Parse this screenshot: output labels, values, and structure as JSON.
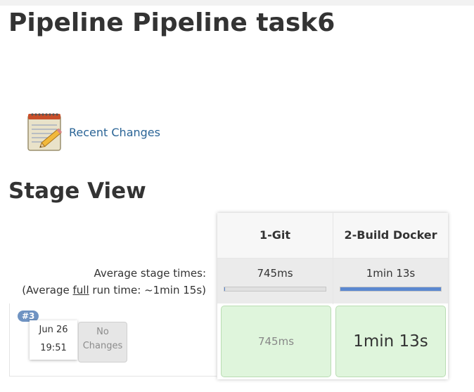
{
  "page": {
    "title": "Pipeline Pipeline task6",
    "recent_changes_label": "Recent Changes",
    "section_title": "Stage View"
  },
  "stage_view": {
    "average_label": "Average stage times:",
    "avg_full_prefix": "(Average ",
    "avg_full_word": "full",
    "avg_full_suffix": " run time: ~1min 15s)",
    "stages": [
      {
        "name": "1-Git",
        "avg_time": "745ms",
        "avg_progress": 0.01
      },
      {
        "name": "2-Build Docker",
        "avg_time": "1min 13s",
        "avg_progress": 1.0
      }
    ],
    "runs": [
      {
        "build": "#3",
        "date": "Jun 26",
        "time": "19:51",
        "changes": [
          "No",
          "Changes"
        ],
        "stage_times": [
          "745ms",
          "1min 13s"
        ]
      }
    ]
  },
  "colors": {
    "link": "#2a6496",
    "badge": "#6f93c2",
    "success_cell": "#dff5dc",
    "progress": "#5b88d0"
  }
}
